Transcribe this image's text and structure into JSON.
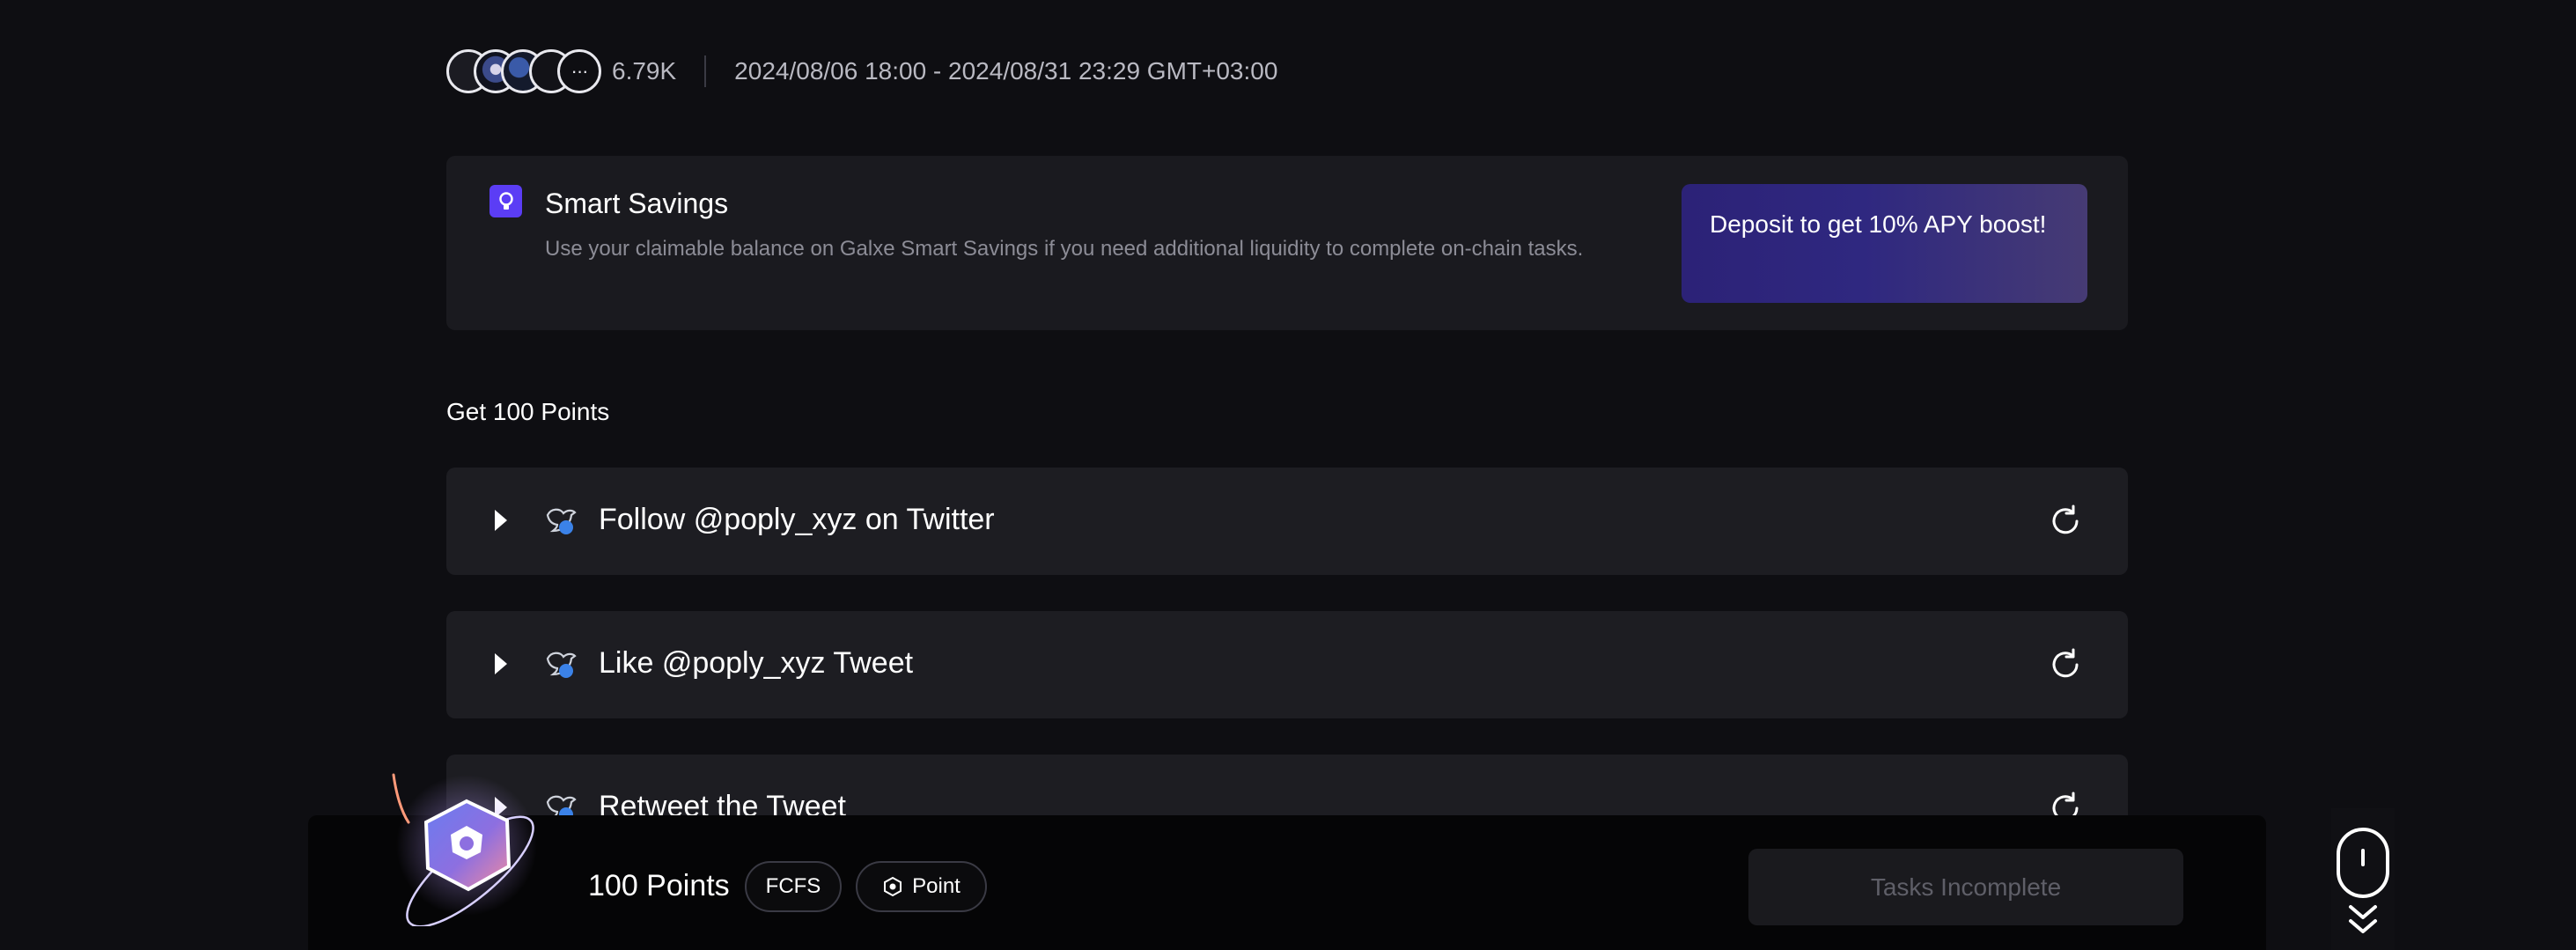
{
  "campaign": {
    "participants": "6.79K",
    "date_range": "2024/08/06 18:00 - 2024/08/31 23:29 GMT+03:00",
    "more_glyph": "···"
  },
  "savings": {
    "title": "Smart Savings",
    "description": "Use your claimable balance on Galxe Smart Savings if you need additional liquidity to complete on-chain tasks.",
    "cta": "Deposit to get 10% APY boost!",
    "icon": "lightbulb-icon",
    "accent": "#5b3df5"
  },
  "tasks_section": {
    "title": "Get 100 Points",
    "tasks": [
      {
        "label": "Follow @poply_xyz on Twitter",
        "icon": "twitter-bird-icon"
      },
      {
        "label": "Like @poply_xyz Tweet",
        "icon": "twitter-bird-icon"
      },
      {
        "label": "Retweet the Tweet",
        "icon": "twitter-bird-icon"
      }
    ]
  },
  "reward_bar": {
    "points": "100 Points",
    "fcfs_label": "FCFS",
    "point_label": "Point",
    "action": "Tasks Incomplete"
  }
}
